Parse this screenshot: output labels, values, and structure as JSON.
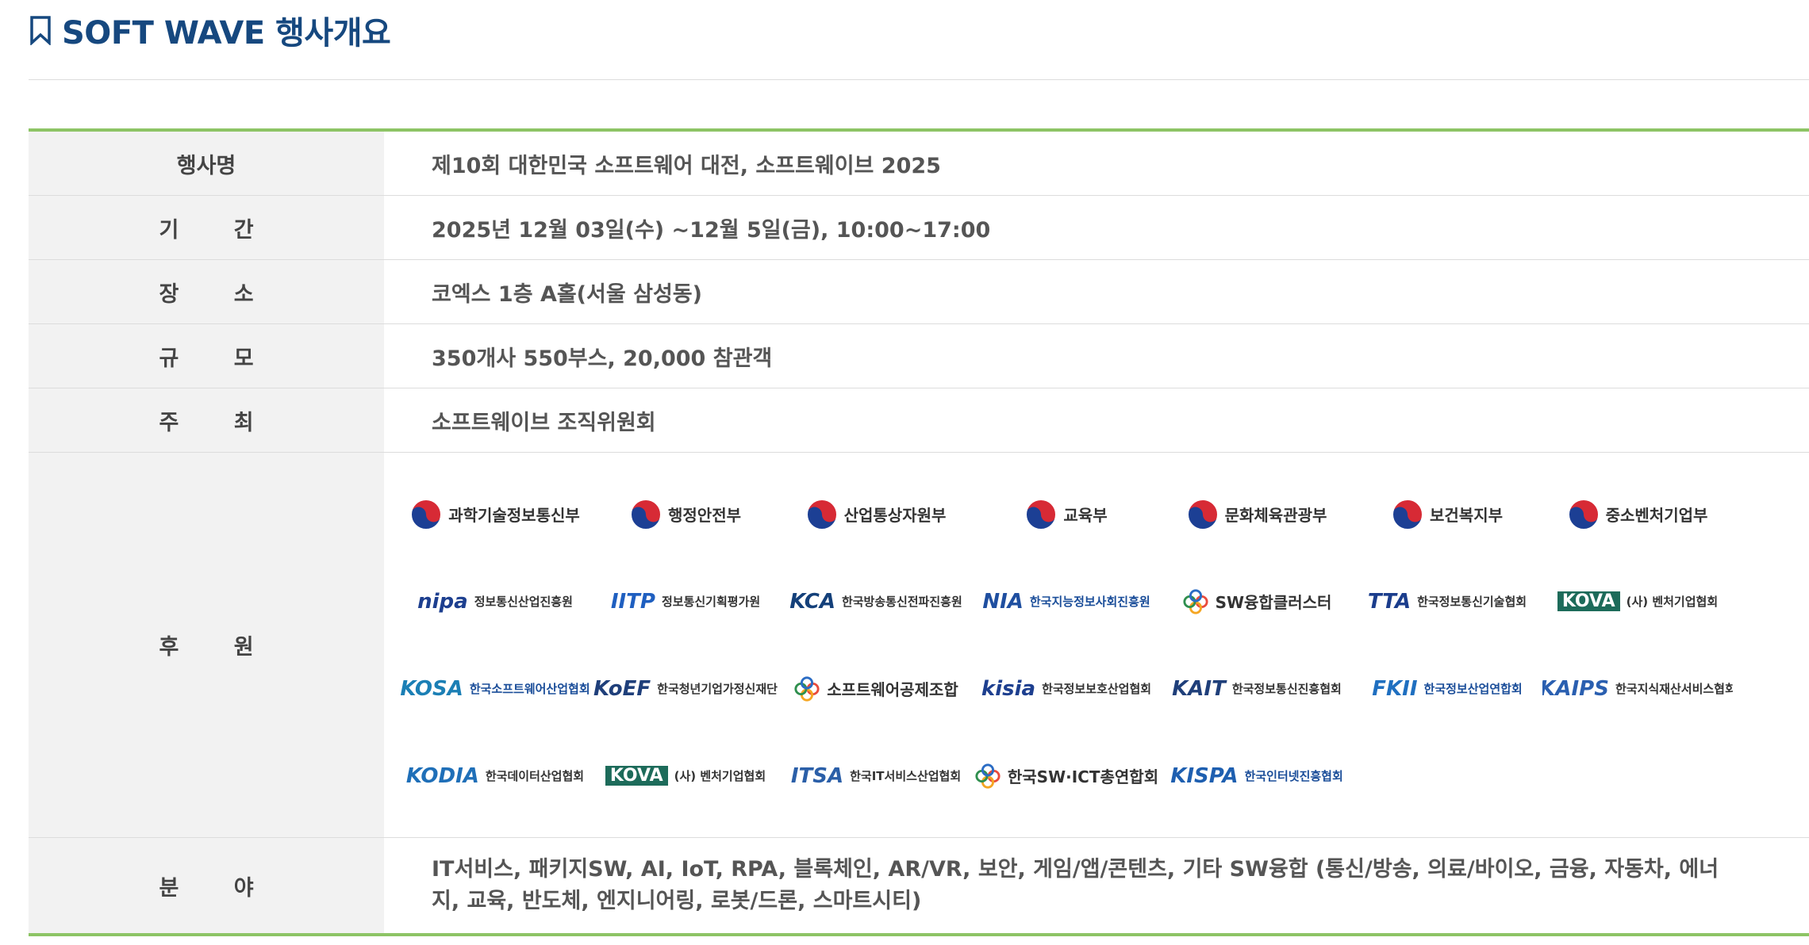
{
  "page": {
    "title": "SOFT WAVE 행사개요"
  },
  "overview": {
    "rows": [
      {
        "label": "행사명",
        "value": "제10회 대한민국 소프트웨어 대전, 소프트웨이브 2025"
      },
      {
        "label": "기 간",
        "value": "2025년 12월 03일(수) ~12월 5일(금), 10:00~17:00"
      },
      {
        "label": "장 소",
        "value": "코엑스 1층 A홀(서울 삼성동)"
      },
      {
        "label": "규 모",
        "value": "350개사 550부스, 20,000 참관객"
      },
      {
        "label": "주 최",
        "value": "소프트웨이브 조직위원회"
      }
    ],
    "sponsor_label": "후 원",
    "field_label": "분 야",
    "field_value": "IT서비스, 패키지SW, AI, IoT, RPA, 블록체인, AR/VR, 보안, 게임/앱/콘텐츠, 기타 SW융합 (통신/방송, 의료/바이오, 금융, 자동차, 에너지, 교육, 반도체, 엔지니어링, 로봇/드론, 스마트시티)"
  },
  "sponsors": [
    {
      "abbr": "",
      "name": "과학기술정보통신부",
      "icon": "korea-gov-emblem-icon"
    },
    {
      "abbr": "",
      "name": "행정안전부",
      "icon": "korea-gov-emblem-icon"
    },
    {
      "abbr": "",
      "name": "산업통상자원부",
      "icon": "korea-gov-emblem-icon"
    },
    {
      "abbr": "",
      "name": "교육부",
      "icon": "korea-gov-emblem-icon"
    },
    {
      "abbr": "",
      "name": "문화체육관광부",
      "icon": "korea-gov-emblem-icon"
    },
    {
      "abbr": "",
      "name": "보건복지부",
      "icon": "korea-gov-emblem-icon"
    },
    {
      "abbr": "",
      "name": "중소벤처기업부",
      "icon": "korea-gov-emblem-icon"
    },
    {
      "abbr": "nipa",
      "name": "정보통신산업진흥원",
      "icon": "nipa-logo-icon"
    },
    {
      "abbr": "IITP",
      "name": "정보통신기획평가원",
      "icon": "iitp-logo-icon"
    },
    {
      "abbr": "KCA",
      "name": "한국방송통신전파진흥원",
      "icon": "kca-logo-icon"
    },
    {
      "abbr": "NIA",
      "name": "한국지능정보사회진흥원",
      "icon": "nia-logo-icon"
    },
    {
      "abbr": "",
      "name": "SW융합클러스터",
      "icon": "sw-cluster-logo-icon"
    },
    {
      "abbr": "TTA",
      "name": "한국정보통신기술협회",
      "icon": "tta-logo-icon"
    },
    {
      "abbr": "KOVA",
      "name": "(사) 벤처기업협회",
      "icon": "kova-logo-icon"
    },
    {
      "abbr": "KOSA",
      "name": "한국소프트웨어산업협회",
      "icon": "kosa-logo-icon"
    },
    {
      "abbr": "KoEF",
      "name": "한국청년기업가정신재단",
      "icon": "koef-logo-icon"
    },
    {
      "abbr": "",
      "name": "소프트웨어공제조합",
      "icon": "sw-mutual-aid-logo-icon"
    },
    {
      "abbr": "kisia",
      "name": "한국정보보호산업협회",
      "icon": "kisia-logo-icon"
    },
    {
      "abbr": "KAIT",
      "name": "한국정보통신진흥협회",
      "icon": "kait-logo-icon"
    },
    {
      "abbr": "FKII",
      "name": "한국정보산업연합회",
      "icon": "fkii-logo-icon"
    },
    {
      "abbr": "KAIPS",
      "name": "한국지식재산서비스협회",
      "icon": "kaips-logo-icon"
    },
    {
      "abbr": "KODIA",
      "name": "한국데이터산업협회",
      "icon": "kodia-logo-icon"
    },
    {
      "abbr": "KOVA",
      "name": "(사) 벤처기업협회",
      "icon": "kova-logo-icon"
    },
    {
      "abbr": "ITSA",
      "name": "한국IT서비스산업협회",
      "icon": "itsa-logo-icon"
    },
    {
      "abbr": "",
      "name": "한국SW·ICT총연합회",
      "icon": "sw-ict-federation-logo-icon"
    },
    {
      "abbr": "KISPA",
      "name": "한국인터넷진흥협회",
      "icon": "kispa-logo-icon"
    }
  ],
  "colors": {
    "title": "#16487f",
    "accent_border": "#8dc465",
    "header_bg": "#f2f2f2"
  }
}
